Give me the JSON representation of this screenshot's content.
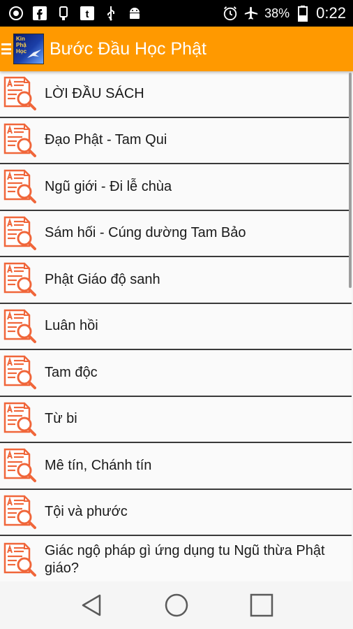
{
  "status_bar": {
    "battery_percent": "38%",
    "time": "0:22",
    "icons": [
      "vpn-icon",
      "facebook-icon",
      "usb-icon",
      "tumblr-icon",
      "usb-debug-icon",
      "android-icon",
      "alarm-icon",
      "airplane-mode-icon",
      "battery-icon"
    ]
  },
  "app_bar": {
    "title": "Bước Đầu Học Phật",
    "logo_text_1": "Kin",
    "logo_text_2": "Phậ",
    "logo_text_3": "Học",
    "background": "#ff9900"
  },
  "list": {
    "items": [
      {
        "label": "LỜI ĐẦU SÁCH"
      },
      {
        "label": "Đạo Phật - Tam Qui"
      },
      {
        "label": "Ngũ giới - Đi lễ chùa"
      },
      {
        "label": "Sám hối - Cúng dường Tam Bảo"
      },
      {
        "label": "Phật Giáo độ sanh"
      },
      {
        "label": "Luân hồi"
      },
      {
        "label": "Tam độc"
      },
      {
        "label": "Từ bi"
      },
      {
        "label": "Mê tín, Chánh tín"
      },
      {
        "label": "Tội và phước"
      },
      {
        "label": "Giác ngộ pháp gì ứng dụng tu Ngũ thừa Phật giáo?"
      }
    ],
    "icon": "document-search-icon",
    "icon_color": "#f0663a"
  },
  "nav_bar": {
    "buttons": [
      "back-icon",
      "home-icon",
      "recents-icon"
    ]
  }
}
